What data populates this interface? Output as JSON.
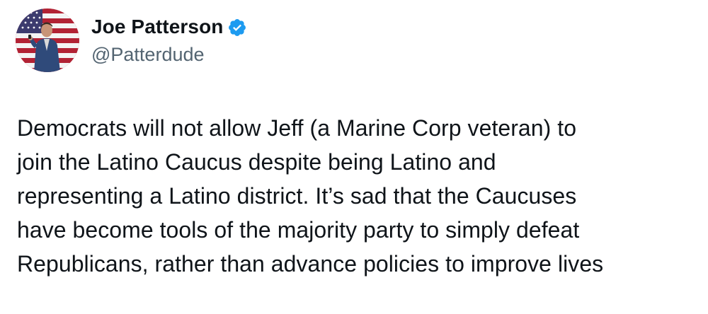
{
  "author": {
    "display_name": "Joe Patterson",
    "handle": "@Patterdude",
    "verified": true,
    "verified_color": "#1d9bf0"
  },
  "tweet": {
    "text": "Democrats will not allow Jeff (a Marine Corp veteran) to\njoin the Latino Caucus despite being Latino and\nrepresenting a Latino district. It’s sad that the Caucuses\nhave become tools of the majority party to simply defeat\nRepublicans, rather than advance policies to improve lives"
  },
  "icons": {
    "verified": "verified-badge-icon",
    "avatar": "profile-photo"
  },
  "colors": {
    "text": "#0f1419",
    "secondary_text": "#536471",
    "background": "#ffffff"
  }
}
